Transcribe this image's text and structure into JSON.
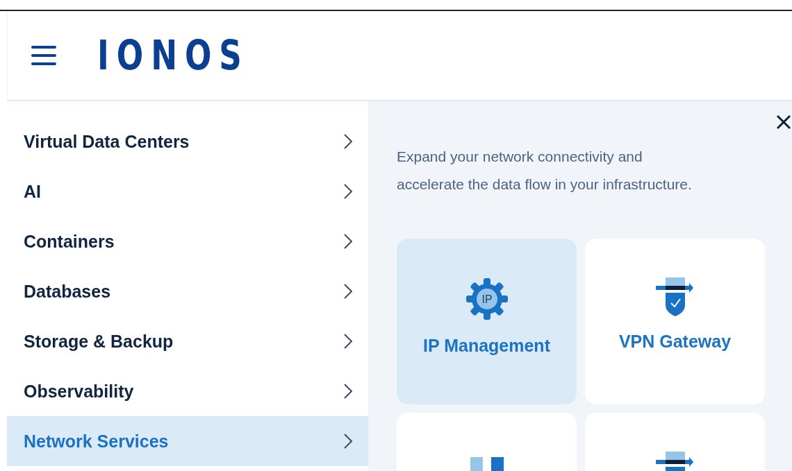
{
  "header": {
    "logo": "IONOS"
  },
  "menu": [
    {
      "label": "Virtual Data Centers",
      "selected": false
    },
    {
      "label": "AI",
      "selected": false
    },
    {
      "label": "Containers",
      "selected": false
    },
    {
      "label": "Databases",
      "selected": false
    },
    {
      "label": "Storage & Backup",
      "selected": false
    },
    {
      "label": "Observability",
      "selected": false
    },
    {
      "label": "Network Services",
      "selected": true
    }
  ],
  "panel": {
    "description": [
      "Expand your network connectivity and",
      "accelerate the data flow in your infrastructure."
    ],
    "cards": [
      {
        "kind": "ip",
        "label": "IP Management",
        "icon_text": "IP",
        "selected": true
      },
      {
        "kind": "vpn",
        "label": "VPN Gateway",
        "selected": false
      },
      {
        "kind": "bars",
        "selected": false
      },
      {
        "kind": "vpn",
        "selected": false
      }
    ]
  }
}
